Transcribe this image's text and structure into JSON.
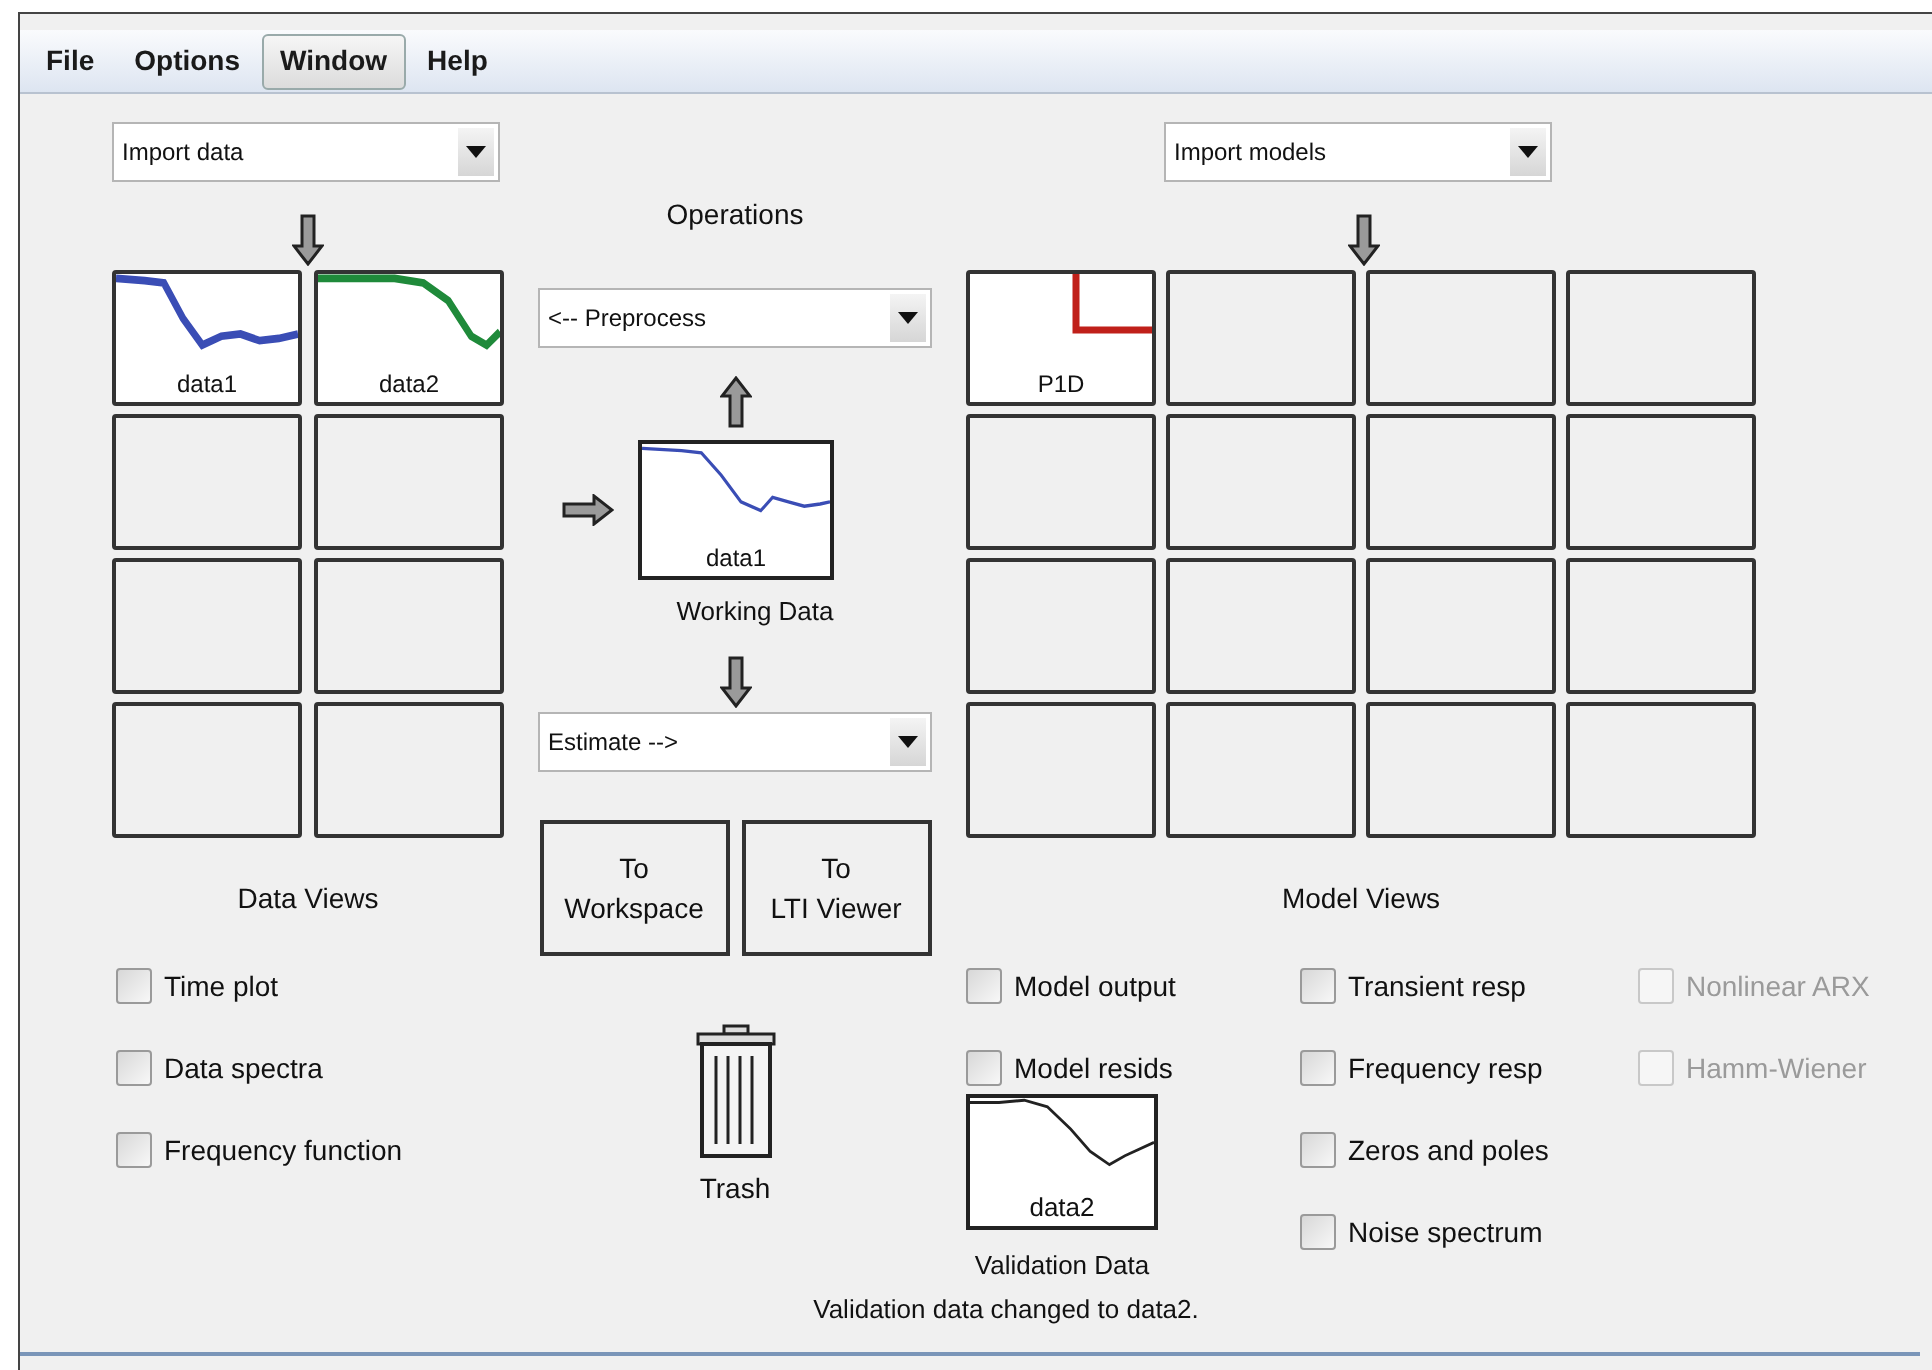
{
  "menu": [
    {
      "label": "File",
      "selected": false
    },
    {
      "label": "Options",
      "selected": false
    },
    {
      "label": "Window",
      "selected": true
    },
    {
      "label": "Help",
      "selected": false
    }
  ],
  "data_import": {
    "value": "Import data"
  },
  "data_boards": [
    {
      "kind": "signal",
      "label": "data1",
      "color": "#3a4db5"
    },
    {
      "kind": "signal",
      "label": "data2",
      "color": "#1f8a3a"
    },
    {
      "kind": "empty"
    },
    {
      "kind": "empty"
    },
    {
      "kind": "empty"
    },
    {
      "kind": "empty"
    },
    {
      "kind": "empty"
    },
    {
      "kind": "empty"
    }
  ],
  "operations": {
    "title": "Operations",
    "preprocess": "<-- Preprocess",
    "working_data": {
      "label": "data1",
      "caption": "Working Data",
      "color": "#3a4db5"
    },
    "estimate": "Estimate -->"
  },
  "buttons": [
    "To\nWorkspace",
    "To\nLTI Viewer"
  ],
  "trash": {
    "label": "Trash"
  },
  "model_import": {
    "value": "Import models"
  },
  "model_boards": [
    {
      "kind": "step",
      "label": "P1D",
      "color": "#c0201a"
    },
    {
      "kind": "empty"
    },
    {
      "kind": "empty"
    },
    {
      "kind": "empty"
    },
    {
      "kind": "empty"
    },
    {
      "kind": "empty"
    },
    {
      "kind": "empty"
    },
    {
      "kind": "empty"
    },
    {
      "kind": "empty"
    },
    {
      "kind": "empty"
    },
    {
      "kind": "empty"
    },
    {
      "kind": "empty"
    },
    {
      "kind": "empty"
    },
    {
      "kind": "empty"
    },
    {
      "kind": "empty"
    },
    {
      "kind": "empty"
    }
  ],
  "data_views": {
    "title": "Data Views",
    "checkboxes": [
      {
        "label": "Time plot",
        "checked": false
      },
      {
        "label": "Data spectra",
        "checked": false
      },
      {
        "label": "Frequency function",
        "checked": false
      }
    ]
  },
  "model_views": {
    "title": "Model Views",
    "columns": [
      [
        {
          "label": "Model output",
          "checked": false,
          "disabled": false
        },
        {
          "label": "Model resids",
          "checked": false,
          "disabled": false
        }
      ],
      [
        {
          "label": "Transient resp",
          "checked": false,
          "disabled": false
        },
        {
          "label": "Frequency resp",
          "checked": false,
          "disabled": false
        },
        {
          "label": "Zeros and poles",
          "checked": false,
          "disabled": false
        },
        {
          "label": "Noise spectrum",
          "checked": false,
          "disabled": false
        }
      ],
      [
        {
          "label": "Nonlinear ARX",
          "checked": false,
          "disabled": true
        },
        {
          "label": "Hamm-Wiener",
          "checked": false,
          "disabled": true
        }
      ]
    ]
  },
  "validation": {
    "label": "data2",
    "caption": "Validation Data",
    "color": "#222222"
  },
  "status": "Validation data changed to data2."
}
